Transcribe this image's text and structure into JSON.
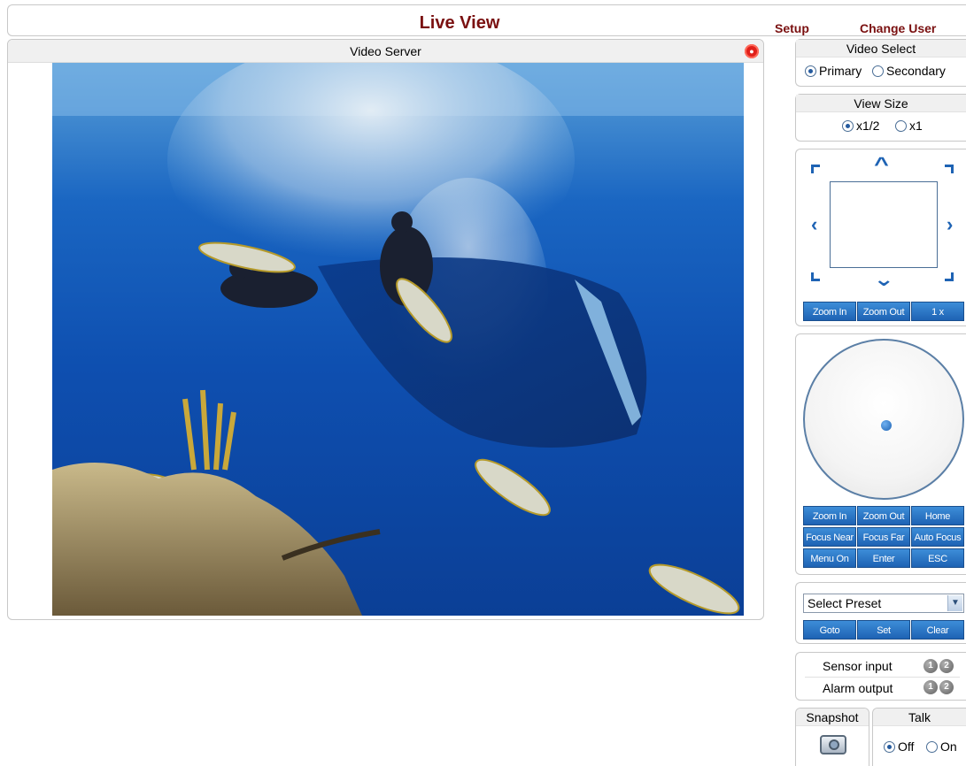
{
  "header": {
    "title": "Live View",
    "links": {
      "setup": "Setup",
      "change_user": "Change User"
    }
  },
  "video": {
    "panel_title": "Video Server",
    "record_icon": "record-icon"
  },
  "video_select": {
    "title": "Video Select",
    "options": [
      "Primary",
      "Secondary"
    ],
    "selected": "Primary"
  },
  "view_size": {
    "title": "View Size",
    "options": [
      "x1/2",
      "x1"
    ],
    "selected": "x1/2"
  },
  "ptz": {
    "buttons": [
      "Zoom In",
      "Zoom Out",
      "1 x"
    ]
  },
  "joystick": {
    "buttons": [
      [
        "Zoom In",
        "Zoom Out",
        "Home"
      ],
      [
        "Focus Near",
        "Focus Far",
        "Auto Focus"
      ],
      [
        "Menu On",
        "Enter",
        "ESC"
      ]
    ]
  },
  "preset": {
    "select_value": "Select Preset",
    "buttons": [
      "Goto",
      "Set",
      "Clear"
    ]
  },
  "io": {
    "sensor_label": "Sensor input",
    "alarm_label": "Alarm output",
    "badges": [
      "1",
      "2"
    ]
  },
  "snapshot": {
    "label": "Snapshot",
    "icon": "camera-icon"
  },
  "talk": {
    "label": "Talk",
    "options": [
      "Off",
      "On"
    ],
    "selected": "Off"
  },
  "colors": {
    "title": "#7a1010",
    "button": "#1e63b4",
    "panel_border": "#c8c8c8"
  }
}
